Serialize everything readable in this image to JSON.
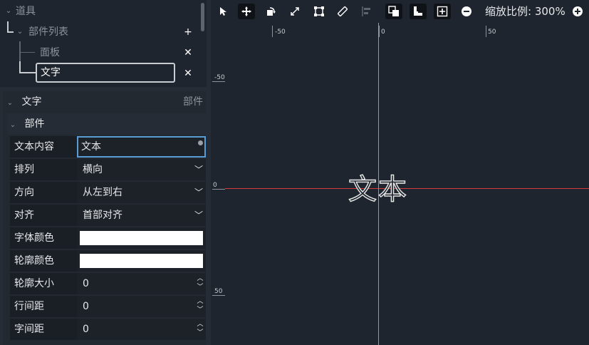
{
  "tree": {
    "root_label": "道具",
    "parts_list_label": "部件列表",
    "items": [
      {
        "label": "面板"
      },
      {
        "label": "文字"
      }
    ],
    "add_symbol": "+",
    "delete_symbol": "✕"
  },
  "props": {
    "component_title": "文字",
    "component_type": "部件",
    "section_title": "部件",
    "rows": [
      {
        "label": "文本内容",
        "value": "文本"
      },
      {
        "label": "排列",
        "value": "横向"
      },
      {
        "label": "方向",
        "value": "从左到右"
      },
      {
        "label": "对齐",
        "value": "首部对齐"
      },
      {
        "label": "字体颜色",
        "color": "#ffffff"
      },
      {
        "label": "轮廓颜色",
        "color": "#ffffff"
      },
      {
        "label": "轮廓大小",
        "value": "0"
      },
      {
        "label": "行间距",
        "value": "0"
      },
      {
        "label": "字间距",
        "value": "0"
      }
    ]
  },
  "toolbar": {
    "icons": [
      "pointer-icon",
      "move-icon",
      "rotate-icon",
      "scale-icon",
      "bounds-icon",
      "ruler-icon",
      "align-icon",
      "bring-front-icon",
      "anchor-icon",
      "fit-icon",
      "zoom-out-icon",
      "zoom-in-icon"
    ],
    "zoom_label": "缩放比例: 300%"
  },
  "canvas": {
    "rulers": {
      "top": [
        "-50",
        "0",
        "50"
      ],
      "left": [
        "-50",
        "0",
        "50"
      ]
    },
    "text": "文本",
    "colors": {
      "x_axis": "#d33a3a",
      "y_axis": "#3fd34a"
    }
  }
}
